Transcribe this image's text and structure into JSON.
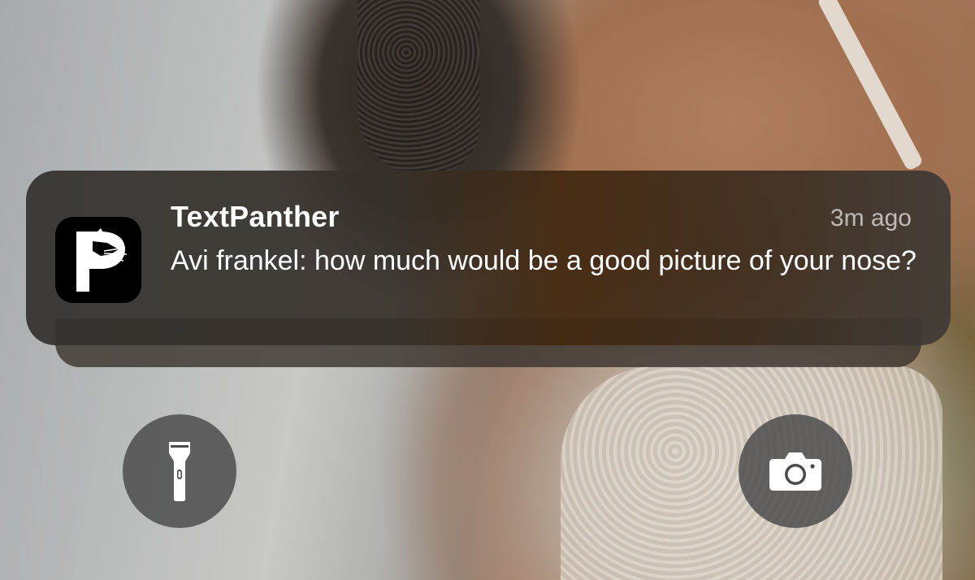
{
  "notification": {
    "app_name": "TextPanther",
    "timestamp": "3m ago",
    "message": "Avi frankel: how much would be a good picture of your nose?",
    "app_icon": "textpanther-panther-icon"
  },
  "lock_screen": {
    "left_button_icon": "flashlight-icon",
    "right_button_icon": "camera-icon"
  }
}
